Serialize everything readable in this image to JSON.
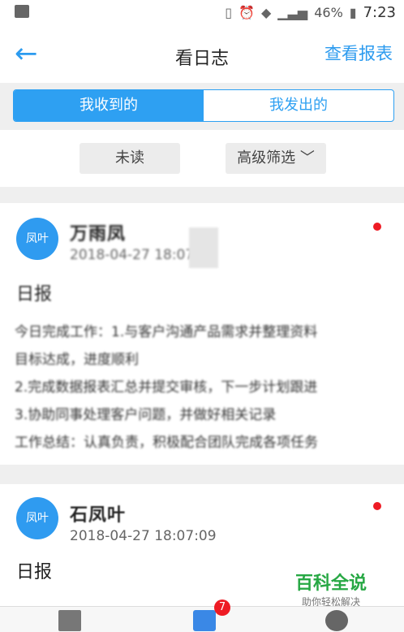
{
  "statusbar": {
    "battery": "46%",
    "time": "7:23"
  },
  "header": {
    "title": "看日志",
    "right_action": "查看报表"
  },
  "segments": {
    "received": "我收到的",
    "sent": "我发出的"
  },
  "filters": {
    "unread": "未读",
    "advanced": "高级筛选"
  },
  "cards": [
    {
      "avatar_text": "凤叶",
      "name": "万雨凤",
      "time": "2018-04-27 18:07:09",
      "type": "日报",
      "lines": [
        "今日完成工作：1.与客户沟通产品需求并整理资料",
        "目标达成，进度顺利",
        "2.完成数据报表汇总并提交审核，下一步计划跟进",
        "3.协助同事处理客户问题，并做好相关记录",
        "工作总结：认真负责，积极配合团队完成各项任务"
      ]
    },
    {
      "avatar_text": "凤叶",
      "name": "石凤叶",
      "time": "2018-04-27 18:07:09",
      "type": "日报"
    }
  ],
  "watermark": {
    "title": "百科全说",
    "subtitle": "助你轻松解决"
  },
  "tabbar": {
    "badge": "7"
  }
}
